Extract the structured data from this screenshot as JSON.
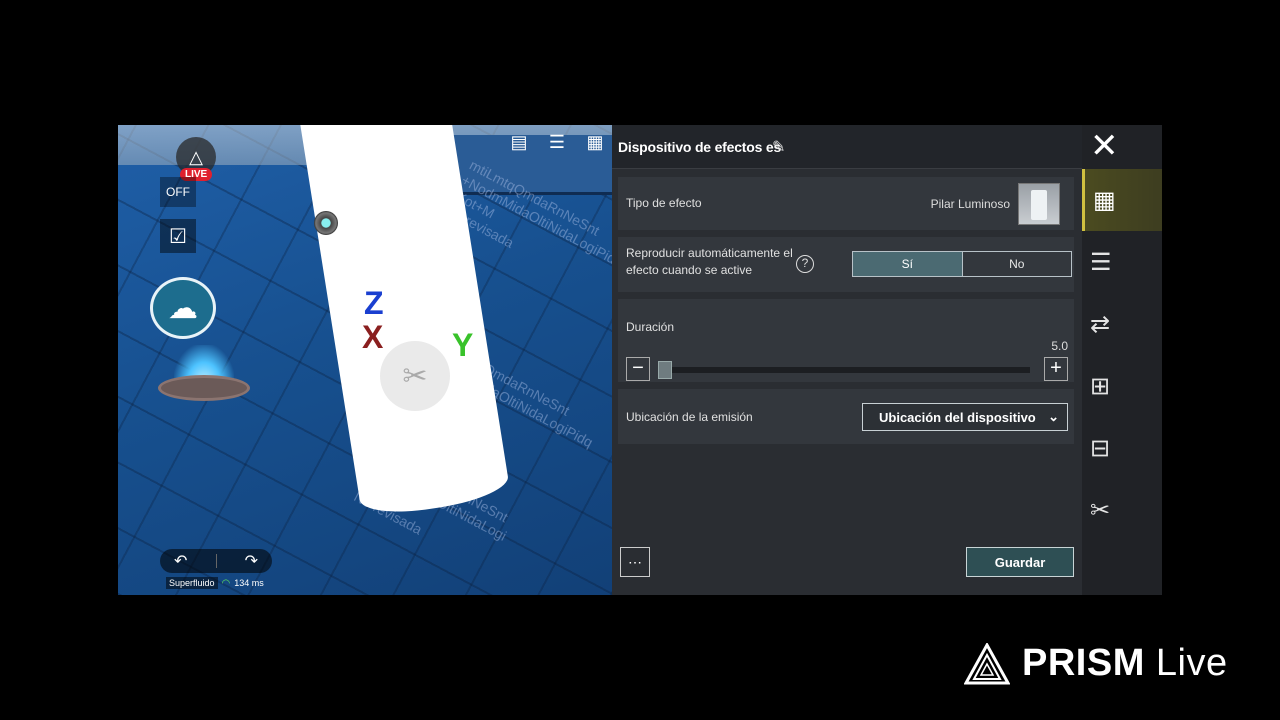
{
  "viewport": {
    "live_badge": "LIVE",
    "grid_label": "OFF",
    "axes": {
      "z": "Z",
      "x": "X",
      "y": "Y"
    },
    "watermarks": [
      "mtiLmtqQmdaRnNeSnt\n+NodmMidaOltiNidaLogiPidq\niKot+M\nNo revisada",
      "mtiLmtqQmdaRnNeSnt\n+NodmMidaOltiNidaLogiPidq\niKot+M\nNo revisada",
      "mtiLmtqQmdaRnNeSnt\n+NodmMidaOltiNidaLogi\niKot+M\nNo revisada"
    ],
    "network": {
      "quality": "Superfluido",
      "ping": "134 ms"
    }
  },
  "panel": {
    "title": "Dispositivo de efectos es",
    "rows": {
      "type": {
        "label": "Tipo de efecto",
        "value": "Pilar Luminoso"
      },
      "autoplay": {
        "label": "Reproducir automáticamente el efecto cuando se active",
        "options": [
          "Sí",
          "No"
        ],
        "selected": "Sí"
      },
      "duration": {
        "label": "Duración",
        "value": "5.0",
        "fraction": 0.02
      },
      "location": {
        "label": "Ubicación de la emisión",
        "selected": "Ubicación del dispositivo"
      }
    },
    "save_label": "Guardar"
  },
  "sidebar": {
    "items": [
      {
        "icon": "blocks-icon",
        "active": true
      },
      {
        "icon": "edit-list-icon",
        "active": false
      },
      {
        "icon": "link-icon",
        "active": false
      },
      {
        "icon": "add-row-icon",
        "active": false
      },
      {
        "icon": "insert-row-icon",
        "active": false
      },
      {
        "icon": "tools-icon",
        "active": false
      }
    ]
  },
  "brand": {
    "name_bold": "PRISM",
    "name_light": "Live"
  },
  "colors": {
    "accent_active": "#d0c040",
    "toggle_active": "#4b6a72",
    "live_red": "#e0202e"
  }
}
